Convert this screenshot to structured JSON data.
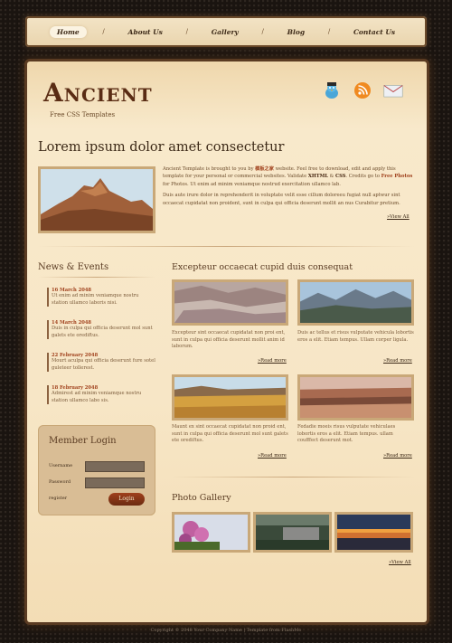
{
  "nav": {
    "items": [
      "Home",
      "About Us",
      "Gallery",
      "Blog",
      "Contact Us"
    ],
    "separator": "/"
  },
  "brand": {
    "logo": "Ancient",
    "tagline": "Free CSS Templates"
  },
  "icons": [
    "twitter-bird-icon",
    "rss-icon",
    "mail-icon"
  ],
  "feature": {
    "headline": "Lorem ipsum dolor amet consectetur",
    "p1_a": "Ancient Template is brought to you by ",
    "p1_b": "模板之家",
    "p1_c": " website. Feel free to download, edit and apply this template for your personal or commercial websites. Validate ",
    "p1_d": "XHTML",
    "p1_e": " & ",
    "p1_f": "CSS",
    "p1_g": ". Credits go to ",
    "p1_h": "Free Photos",
    "p1_i": " for Photos. Ut enim ad minim veniamque nostrud exercitation ullamco lab.",
    "p2": "Duis aute irure dolor in reprehenderit in voluptate velit esse cillum doloreeu fugiat null aptwur sint occaecat cupidatat non proident, sunt in culpa qui officia deserunt mollit an nus Curabitur pretium.",
    "view_all": "View All"
  },
  "news": {
    "title": "News & Events",
    "items": [
      {
        "date": "16 March 2048",
        "text": "Ut enim ad minim veniamque nostru station ullamco laboris nisi."
      },
      {
        "date": "14 March 2048",
        "text": "Duis in culpa qui officia deserunt mol sunt galets ete orediftus."
      },
      {
        "date": "22 February 2048",
        "text": "Mourt aculpa qui officia deserunt fure sotel guleteer tollerest."
      },
      {
        "date": "18 February 2048",
        "text": "Admirest ad minim veniamque nostru station ullamco labo sis."
      }
    ]
  },
  "login": {
    "title": "Member Login",
    "username_label": "Username",
    "password_label": "Password",
    "register_label": "register",
    "button": "Login"
  },
  "articles": {
    "title": "Excepteur occaecat cupid duis consequat",
    "items": [
      {
        "text": "Excepteur sint occaecat cupidatat non proi ent, sunt in culpa qui officia deserunt mollit anim id laborum.",
        "more": "Read more"
      },
      {
        "text": "Duis ac tellus et risus vulputate vehicula lobortis eros a elit. Etiam tempus. Ullam corper ligula.",
        "more": "Read more"
      },
      {
        "text": "Maunt ex sint occaecat cupidatat non proid ent, sunt in culpa qui officia deserunt mol sunt galets ete orediftus.",
        "more": "Read more"
      },
      {
        "text": "Fedadie moeis risus vulputate vehiculaes lobortis eros a elit. Etiam tempus. ullam coufffect deserunt mot.",
        "more": "Read more"
      }
    ]
  },
  "gallery": {
    "title": "Photo Gallery",
    "view_all": "View All"
  },
  "footer": "Copyright © 2048 Your Company Name | Template from FlashMo"
}
